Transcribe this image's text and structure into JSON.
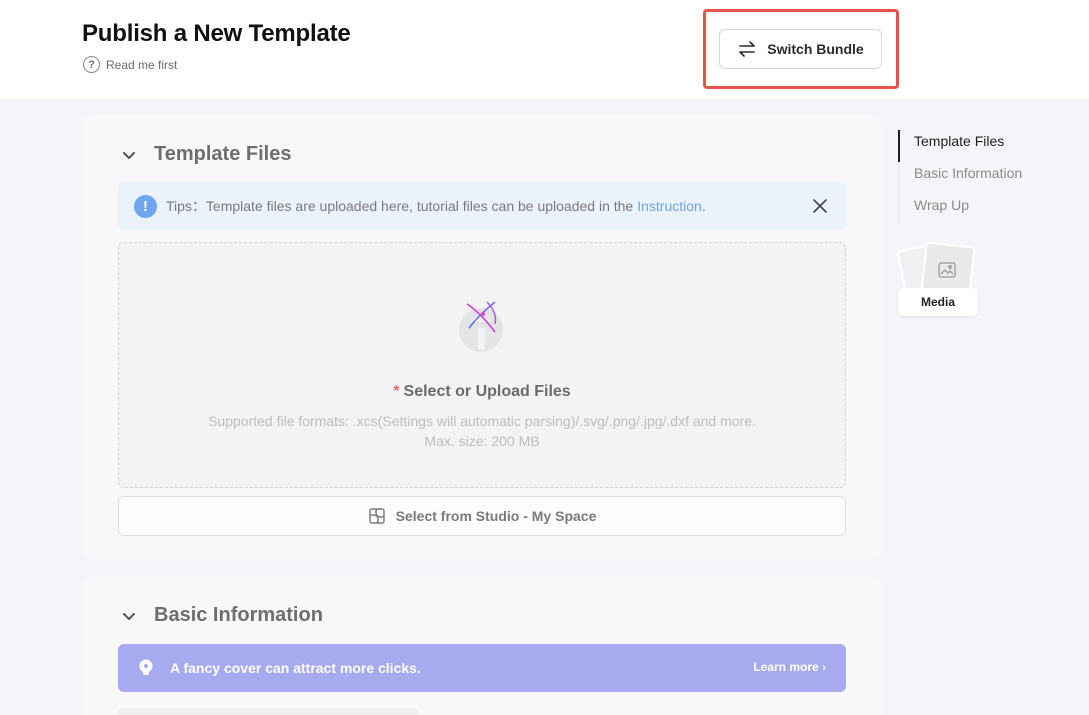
{
  "header": {
    "title": "Publish a New Template",
    "read_me": "Read me first",
    "switch_bundle": "Switch Bundle"
  },
  "template_files": {
    "title": "Template Files",
    "tips": {
      "prefix": "Tips：Template files are uploaded here, tutorial files can be uploaded in the",
      "link": "Instruction",
      "suffix": "."
    },
    "upload": {
      "required_mark": "*",
      "title": "Select or Upload Files",
      "formats": "Supported file formats: .xcs(Settings will automatic parsing)/.svg/.png/.jpg/.dxf and more.",
      "max_size": "Max. size: 200 MB"
    },
    "studio_button": "Select from Studio - My Space"
  },
  "basic_information": {
    "title": "Basic Information",
    "promo": "A fancy cover can attract more clicks.",
    "learn_more": "Learn more ›"
  },
  "toc": {
    "items": [
      "Template Files",
      "Basic Information",
      "Wrap Up"
    ],
    "active_index": 0
  },
  "media": {
    "label": "Media"
  },
  "colors": {
    "highlight": "#e5534b",
    "tips_bg": "#eaf2fc",
    "link": "#6ea5ec",
    "promo_bg": "#a7aaee"
  }
}
